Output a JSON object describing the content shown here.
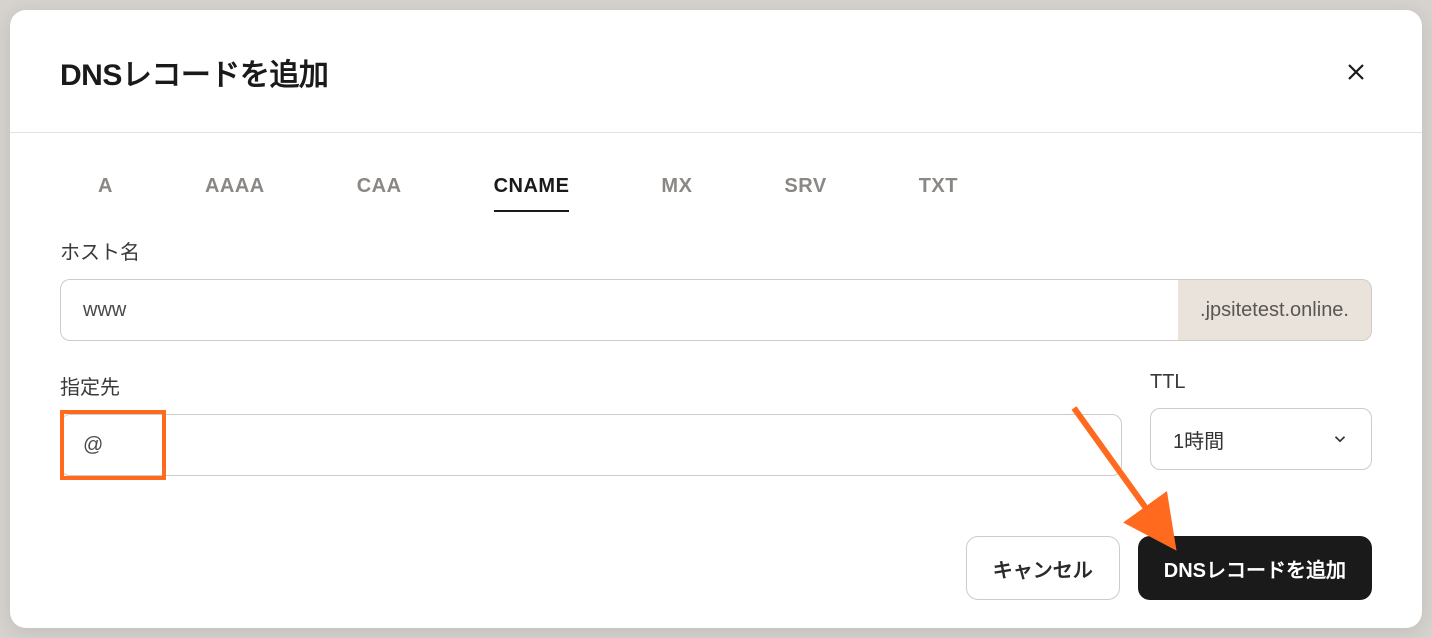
{
  "modal": {
    "title": "DNSレコードを追加"
  },
  "tabs": {
    "items": [
      "A",
      "AAAA",
      "CAA",
      "CNAME",
      "MX",
      "SRV",
      "TXT"
    ],
    "active_index": 3
  },
  "form": {
    "hostname": {
      "label": "ホスト名",
      "value": "www",
      "suffix": ".jpsitetest.online."
    },
    "points_to": {
      "label": "指定先",
      "value": "@"
    },
    "ttl": {
      "label": "TTL",
      "value": "1時間"
    }
  },
  "footer": {
    "cancel": "キャンセル",
    "submit": "DNSレコードを追加"
  },
  "annotation": {
    "highlight_color": "#ff6a1f"
  }
}
